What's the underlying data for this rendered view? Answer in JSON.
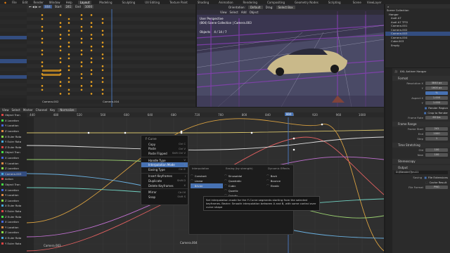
{
  "menubar": {
    "items": [
      "File",
      "Edit",
      "Render",
      "Window",
      "Help"
    ],
    "workspaces": [
      "Layout",
      "Modeling",
      "Sculpting",
      "UV Editing",
      "Texture Paint",
      "Shading",
      "Animation",
      "Rendering",
      "Compositing",
      "Geometry Nodes",
      "Scripting"
    ],
    "active_workspace": "Layout",
    "scene_name": "Scene",
    "view_layer": "ViewLayer"
  },
  "timeline": {
    "start_label": "Start",
    "start": "241",
    "end_label": "End",
    "end": "1000",
    "frame": "804",
    "playhead_label": "804",
    "labels": [
      "Camera.002",
      "Camera.004"
    ]
  },
  "viewport": {
    "orientation_label": "Orientation:",
    "orientation": "Default",
    "drag_label": "Drag:",
    "drag": "Select Box",
    "menus": [
      "View",
      "Select",
      "Add",
      "Object"
    ],
    "title": "User Perspective",
    "subtitle": "(804) Scene Collection | Camera.003",
    "objects_label": "Objects",
    "objects": "4 / 14 / 7"
  },
  "outliner": {
    "items": [
      "Scene Collection",
      "Hangar",
      "Audi A7",
      "Audi A7 TFSI",
      "Camera.001",
      "Camera.002",
      "Camera.003",
      "Camera.004",
      "Cube.003",
      "Empty"
    ]
  },
  "props": {
    "title": "XXL Antiner Hangar",
    "format": "Format",
    "res_x_label": "Resolution X",
    "res_x": "3840 px",
    "res_y_label": "Y",
    "res_y": "1600 px",
    "pct": "%",
    "aspect_x_label": "Aspect X",
    "aspect_x": "1.000",
    "aspect_y_label": "Y",
    "aspect_y": "1.000",
    "render_region": "Render Region",
    "crop": "Crop to Render",
    "frame_rate_label": "Frame Rate",
    "frame_rate": "60 fps",
    "frame_range": "Frame Range",
    "start_label": "Frame Start",
    "start": "241",
    "end_label": "End",
    "end": "1000",
    "step_label": "Step",
    "step": "1",
    "time_stretching": "Time Stretching",
    "old_label": "Old",
    "old": "100",
    "new_label": "New",
    "new": "100",
    "stereoscopy": "Stereoscopy",
    "output": "Output",
    "output_path": "D:\\Blender\\Tyru11",
    "saving_label": "Saving",
    "file_ext": "File Extensions",
    "cache_result": "Cache Result",
    "file_format_label": "File Format",
    "file_format": "PNG"
  },
  "graph": {
    "menus": [
      "View",
      "Select",
      "Marker",
      "Channel",
      "Key"
    ],
    "normalize": "Normalize",
    "ticks": [
      "440",
      "480",
      "520",
      "560",
      "600",
      "640",
      "680",
      "720",
      "760",
      "800",
      "840",
      "880",
      "920",
      "960",
      "1000"
    ],
    "playhead": "804",
    "bottom_labels": [
      "Camera.004",
      "Camera.003"
    ],
    "channels": [
      "Object Tran",
      "X Location",
      "Y Location",
      "Z Location",
      "X Euler Rota",
      "Y Euler Rota",
      "Z Euler Rota",
      "Object Tran",
      "X Location",
      "Y Location",
      "Z Location",
      "Camera.003",
      "Action",
      "Object Tran",
      "X Location",
      "Y Location",
      "Z Location",
      "X Euler Rota",
      "Y Euler Rota",
      "Z Euler Rota",
      "X Location",
      "Y Location",
      "Z Location",
      "X Euler Rota",
      "Y Euler Rota"
    ]
  },
  "context_menu": {
    "title": "F-Curve",
    "items": [
      {
        "label": "Copy",
        "sc": "Ctrl C"
      },
      {
        "label": "Paste",
        "sc": "Ctrl V"
      },
      {
        "label": "Paste Flipped",
        "sc": "Shift Ctrl V"
      },
      {
        "label": "Handle Type",
        "sc": "V"
      },
      {
        "label": "Interpolation Mode",
        "sc": "T"
      },
      {
        "label": "Easing Type",
        "sc": "Ctrl E"
      },
      {
        "label": "Insert Keyframes",
        "sc": "I"
      },
      {
        "label": "Duplicate",
        "sc": "Shift D"
      },
      {
        "label": "Delete Keyframes",
        "sc": "X"
      },
      {
        "label": "Mirror",
        "sc": "Ctrl M"
      },
      {
        "label": "Snap",
        "sc": "Shift S"
      }
    ]
  },
  "interp_menu": {
    "col1_title": "Interpolation",
    "col1": [
      "Constant",
      "Linear",
      "Bézier"
    ],
    "col2_title": "Easing (by strength)",
    "col2": [
      "Sinusoidal",
      "Quadratic",
      "Cubic",
      "Quartic",
      "Quintic",
      "Exponential",
      "Circular"
    ],
    "col3_title": "Dynamic Effects",
    "col3": [
      "Back",
      "Bounce",
      "Elastic"
    ],
    "tooltip": "Set interpolation mode for the F-Curve segments starting from the selected keyframes. Bezier: Smooth interpolation between A and B, with some control over curve shape"
  }
}
